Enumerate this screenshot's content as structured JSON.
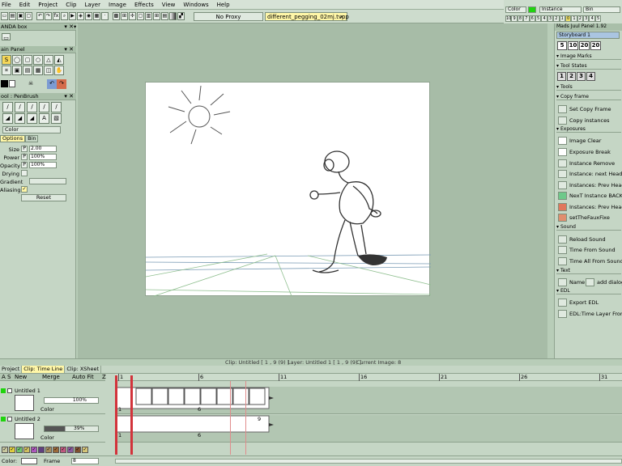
{
  "menu": [
    "File",
    "Edit",
    "Project",
    "Clip",
    "Layer",
    "Image",
    "Effects",
    "View",
    "Windows",
    "Help"
  ],
  "toolbar": {
    "proxy_label": "No Proxy",
    "file_tab": "different_pegging_02mj.tvpp",
    "file_tab_close": "×"
  },
  "top_right": {
    "color_label": "Color",
    "instance_label": "Instance",
    "bin_label": "Bin",
    "numbers": [
      "10",
      "9",
      "8",
      "7",
      "6",
      "5",
      "4",
      "3",
      "2",
      "1",
      "0",
      "1",
      "2",
      "3",
      "4",
      "5"
    ],
    "highlight_index": 10
  },
  "left_panel": {
    "top_title": "ANDA box",
    "main_panel_title": "ain Panel",
    "tool_title": "ool : PenBrush",
    "color_combo": "Color",
    "tabs": [
      "Options",
      "Bin"
    ],
    "size_label": "Size",
    "size_prefix": "P",
    "size_value": "2.00",
    "power_label": "Power",
    "power_prefix": "P",
    "power_value": "100%",
    "opacity_label": "Opacity",
    "opacity_prefix": "P",
    "opacity_value": "100%",
    "drying_label": "Drying",
    "gradient_label": "Gradient",
    "aliasing_label": "Aliasing",
    "aliasing_check": "✓",
    "reset_label": "Reset"
  },
  "right_panel": {
    "title": "Mads Juul Panel 1.92",
    "storyboard": "Storyboard 1",
    "number_buttons": [
      "5",
      "10",
      "20",
      "20"
    ],
    "image_marks": "Image Marks",
    "tool_states": "Tool States",
    "state_buttons": [
      "1",
      "2",
      "3",
      "4"
    ],
    "tools": "Tools",
    "copy_frame": "Copy frame",
    "set_copy_frame": "Set Copy Frame",
    "copy_instances": "Copy instances",
    "exposures": "Exposures",
    "image_clear": "Image Clear",
    "exposure_break": "Exposure Break",
    "instance_remove": "Instance Remove",
    "instance_next_head": "Instance: next Head to c",
    "instances_prev_head": "Instances: Prev Head T",
    "next_instance_back": "NexT Instance BACK",
    "instances_prev_head2": "Instances: Prev Head T",
    "set_the_faux_fixe": "setTheFauxFixe",
    "sound": "Sound",
    "reload_sound": "Reload Sound",
    "time_from_sound": "Time From Sound",
    "time_all_from_sound": "Time All From Sound",
    "text": "Text",
    "name_label": "Name",
    "add_dialog": "add dialog",
    "edl": "EDL",
    "export_edl": "Export EDL",
    "edl_time_layer": "EDL:Time Layer From E"
  },
  "status": {
    "clip": "Clip: Untitled [ 1 , 9  (9) ]",
    "layer": "Layer: Untitled 1 [ 1 , 9  (9) ]",
    "current_image": "Current Image: 8"
  },
  "timeline": {
    "tabs": [
      "Project",
      "Clip: Time Line",
      "Clip: XSheet"
    ],
    "active_tab": 1,
    "header_new": "New",
    "header_merge": "Merge",
    "header_autofit": "Auto Fit",
    "header_a": "A",
    "header_s": "S",
    "header_z": "Z",
    "ruler_marks": [
      "1",
      "6",
      "11",
      "16",
      "21",
      "26",
      "31"
    ],
    "layer1_name": "Untitled 1",
    "layer1_opacity": "100%",
    "layer1_mode": "Color",
    "layer1_frame_start": "1",
    "layer1_frame_mid": "6",
    "layer2_name": "Untitled 2",
    "layer2_opacity": "39%",
    "layer2_mode": "Color",
    "layer2_frame_start": "1",
    "layer2_frame_mid": "6",
    "layer2_frame_end": "9",
    "color_label": "Color:",
    "frame_label": "Frame",
    "frame_value": "8"
  },
  "colors": {
    "accent_yellow": "#fff7a8",
    "playhead_red": "#d2333b",
    "panel_green": "#c5d6c5",
    "canvas_bg": "#a7bca7"
  }
}
